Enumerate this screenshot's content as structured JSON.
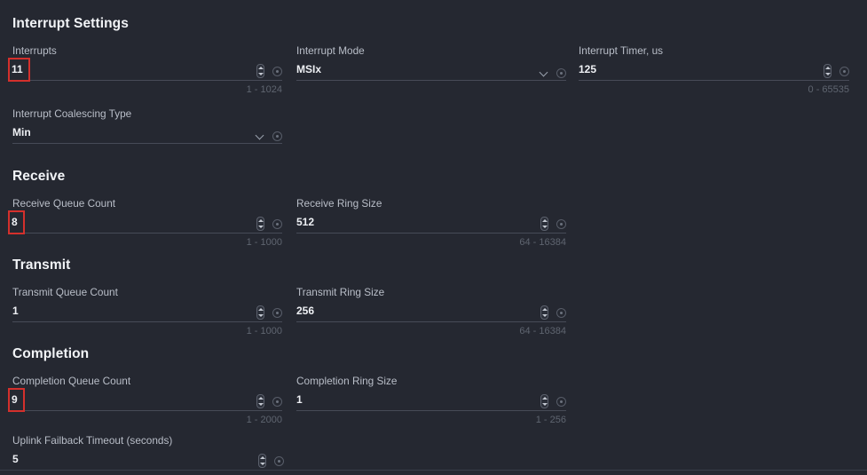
{
  "sections": [
    {
      "id": "interrupt-settings",
      "title": "Interrupt Settings",
      "fields": [
        {
          "id": "interrupts",
          "label": "Interrupts",
          "value": "11",
          "range": "1 - 1024",
          "control": "spinner",
          "highlighted": true
        },
        {
          "id": "interrupt-mode",
          "label": "Interrupt Mode",
          "value": "MSIx",
          "range": "",
          "control": "select",
          "highlighted": false
        },
        {
          "id": "interrupt-timer",
          "label": "Interrupt Timer, us",
          "value": "125",
          "range": "0 - 65535",
          "control": "spinner",
          "highlighted": false
        },
        {
          "id": "interrupt-coalescing-type",
          "label": "Interrupt Coalescing Type",
          "value": "Min",
          "range": "",
          "control": "select",
          "highlighted": false
        }
      ]
    },
    {
      "id": "receive",
      "title": "Receive",
      "fields": [
        {
          "id": "receive-queue-count",
          "label": "Receive Queue Count",
          "value": "8",
          "range": "1 - 1000",
          "control": "spinner",
          "highlighted": true
        },
        {
          "id": "receive-ring-size",
          "label": "Receive Ring Size",
          "value": "512",
          "range": "64 - 16384",
          "control": "spinner",
          "highlighted": false
        }
      ]
    },
    {
      "id": "transmit",
      "title": "Transmit",
      "fields": [
        {
          "id": "transmit-queue-count",
          "label": "Transmit Queue Count",
          "value": "1",
          "range": "1 - 1000",
          "control": "spinner",
          "highlighted": false
        },
        {
          "id": "transmit-ring-size",
          "label": "Transmit Ring Size",
          "value": "256",
          "range": "64 - 16384",
          "control": "spinner",
          "highlighted": false
        }
      ]
    },
    {
      "id": "completion",
      "title": "Completion",
      "fields": [
        {
          "id": "completion-queue-count",
          "label": "Completion Queue Count",
          "value": "9",
          "range": "1 - 2000",
          "control": "spinner",
          "highlighted": true
        },
        {
          "id": "completion-ring-size",
          "label": "Completion Ring Size",
          "value": "1",
          "range": "1 - 256",
          "control": "spinner",
          "highlighted": false
        },
        {
          "id": "uplink-failback-timeout",
          "label": "Uplink Failback Timeout (seconds)",
          "value": "5",
          "range": "",
          "control": "spinner",
          "highlighted": false
        }
      ]
    }
  ],
  "icons": {
    "spinner": "spinner-stepper-icon",
    "chevron": "chevron-down-icon",
    "info": "info-icon"
  },
  "colors": {
    "background": "#252831",
    "highlight": "#d4302c",
    "underline": "#474b57",
    "label": "#b9bec8",
    "value": "#eef0f4",
    "range": "#5f6570"
  }
}
